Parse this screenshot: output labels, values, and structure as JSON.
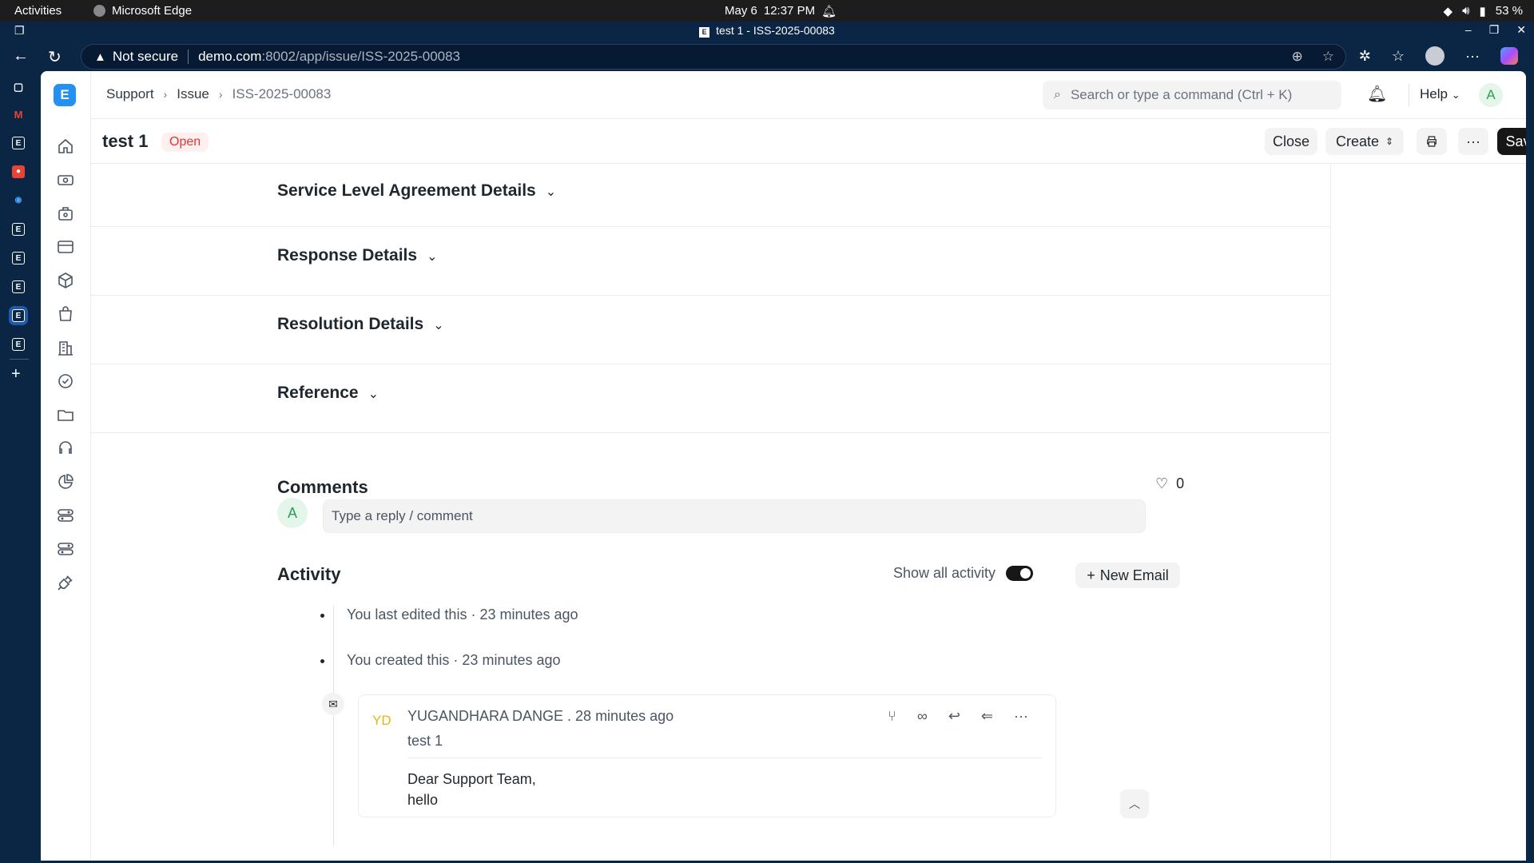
{
  "os": {
    "activities": "Activities",
    "app_name": "Microsoft Edge",
    "date": "May 6",
    "time": "12:37 PM",
    "battery": "53 %"
  },
  "browser": {
    "tab_title": "test 1 - ISS-2025-00083",
    "not_secure": "Not secure",
    "url_host": "demo.com",
    "url_path": ":8002/app/issue/ISS-2025-00083"
  },
  "navbar": {
    "breadcrumbs": [
      "Support",
      "Issue",
      "ISS-2025-00083"
    ],
    "search_placeholder": "Search or type a command (Ctrl + K)",
    "help_label": "Help",
    "avatar_initial": "A"
  },
  "header": {
    "title": "test 1",
    "status": "Open",
    "close_label": "Close",
    "create_label": "Create",
    "save_label": "Save",
    "more_label": "···"
  },
  "sections": [
    {
      "title": "Service Level Agreement Details"
    },
    {
      "title": "Response Details"
    },
    {
      "title": "Resolution Details"
    },
    {
      "title": "Reference"
    }
  ],
  "comments": {
    "title": "Comments",
    "like_count": "0",
    "avatar_initial": "A",
    "placeholder": "Type a reply / comment"
  },
  "activity": {
    "title": "Activity",
    "show_all_label": "Show all activity",
    "show_all_on": true,
    "new_email_label": "New Email",
    "items": [
      {
        "text": "You last edited this · 23 minutes ago"
      },
      {
        "text": "You created this · 23 minutes ago"
      }
    ],
    "email": {
      "initials": "YD",
      "from": "YUGANDHARA DANGE . 28 minutes ago",
      "subject": "test 1",
      "body_line1": "Dear Support Team,",
      "body_line2": "hello"
    }
  },
  "colors": {
    "accent": "#2490ef",
    "status_open": "#e03636",
    "primary_button": "#171717",
    "browser_chrome": "#0b2545"
  }
}
